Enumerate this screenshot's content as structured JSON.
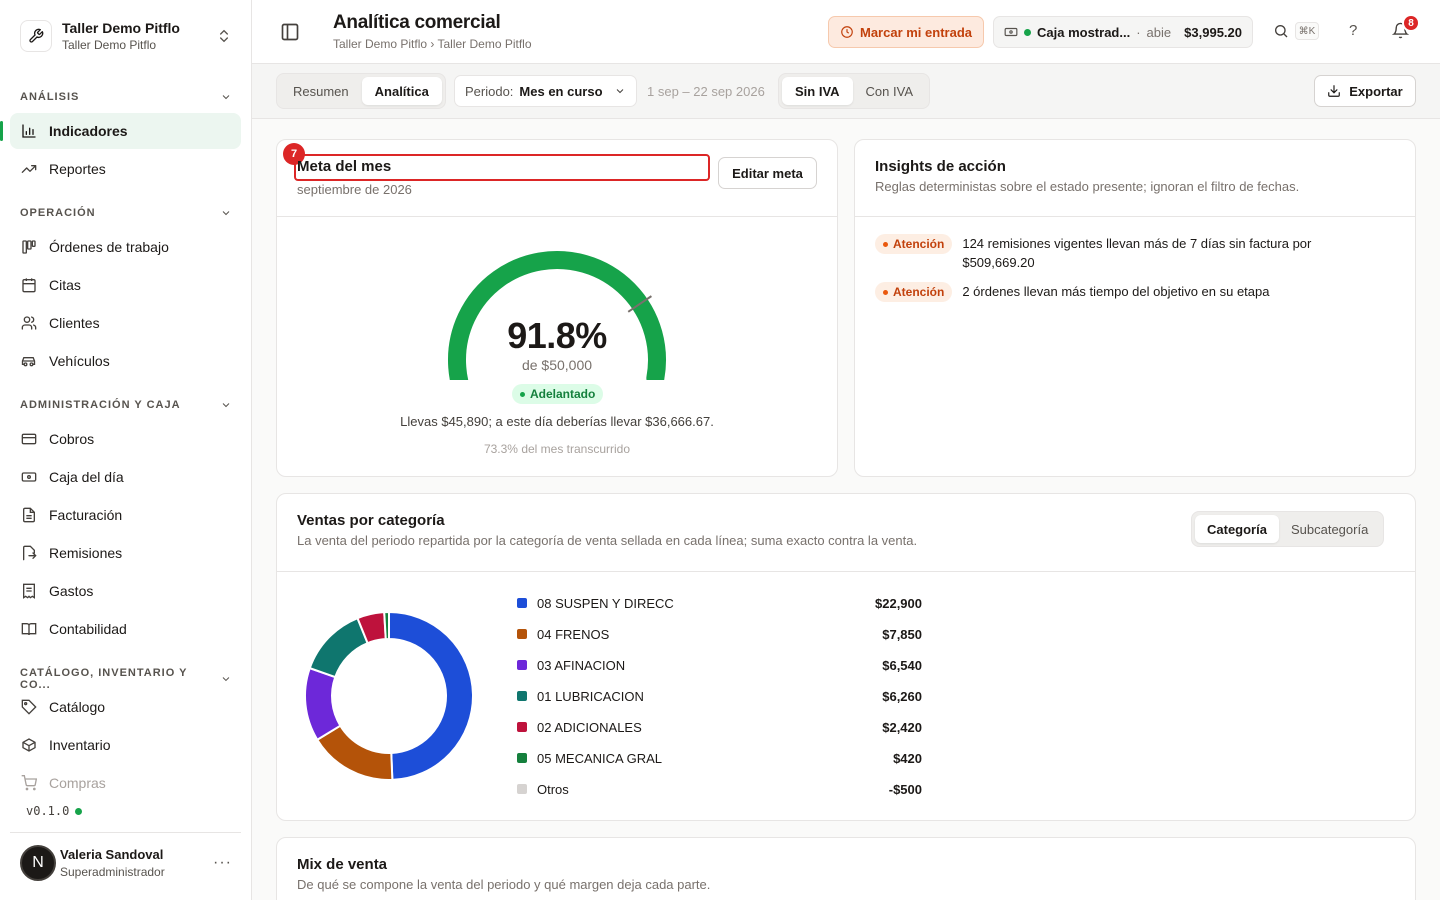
{
  "org": {
    "name": "Taller Demo Pitflo",
    "sub": "Taller Demo Pitflo"
  },
  "sidebar": {
    "sections": [
      {
        "title": "ANÁLISIS"
      },
      {
        "title": "OPERACIÓN"
      },
      {
        "title": "ADMINISTRACIÓN Y CAJA"
      },
      {
        "title": "CATÁLOGO, INVENTARIO Y CO..."
      }
    ],
    "items": [
      {
        "label": "Indicadores",
        "icon": "bar-chart-icon"
      },
      {
        "label": "Reportes",
        "icon": "trending-up-icon"
      },
      {
        "label": "Órdenes de trabajo",
        "icon": "kanban-icon"
      },
      {
        "label": "Citas",
        "icon": "calendar-icon"
      },
      {
        "label": "Clientes",
        "icon": "users-icon"
      },
      {
        "label": "Vehículos",
        "icon": "car-icon"
      },
      {
        "label": "Cobros",
        "icon": "wallet-icon"
      },
      {
        "label": "Caja del día",
        "icon": "banknote-icon"
      },
      {
        "label": "Facturación",
        "icon": "file-text-icon"
      },
      {
        "label": "Remisiones",
        "icon": "file-export-icon"
      },
      {
        "label": "Gastos",
        "icon": "receipt-icon"
      },
      {
        "label": "Contabilidad",
        "icon": "book-icon"
      },
      {
        "label": "Catálogo",
        "icon": "tags-icon"
      },
      {
        "label": "Inventario",
        "icon": "box-icon"
      },
      {
        "label": "Compras",
        "icon": "cart-icon"
      }
    ],
    "version": "v0.1.0"
  },
  "user": {
    "initial": "N",
    "name": "Valeria Sandoval",
    "role": "Superadministrador"
  },
  "header": {
    "title": "Analítica comercial",
    "breadcrumb": "Taller Demo Pitflo › Taller Demo Pitflo",
    "checkin_label": "Marcar mi entrada",
    "cash": {
      "name": "Caja mostrad...",
      "status": "abie",
      "amount": "$3,995.20"
    },
    "shortcut": "⌘K",
    "help": "?",
    "notifications": "8"
  },
  "toolbar": {
    "tabs": [
      "Resumen",
      "Analítica"
    ],
    "period_label": "Periodo:",
    "period_value": "Mes en curso",
    "range": "1 sep – 22 sep 2026",
    "tax_tabs": [
      "Sin IVA",
      "Con IVA"
    ],
    "export_label": "Exportar"
  },
  "goal": {
    "marker": "7",
    "title": "Meta del mes",
    "date": "septiembre de 2026",
    "edit_label": "Editar meta",
    "percent_text": "91.8%",
    "progress": 0.918,
    "expected": 0.733,
    "of_text": "de $50,000",
    "status": "Adelantado",
    "message": "Llevas $45,890; a este día deberías llevar $36,666.67.",
    "elapsed": "73.3% del mes transcurrido",
    "colors": {
      "fill": "#16a34a",
      "track": "#e7e5e4",
      "tick": "#78716c"
    }
  },
  "insights": {
    "title": "Insights de acción",
    "sub": "Reglas deterministas sobre el estado presente; ignoran el filtro de fechas.",
    "items": [
      {
        "tag": "Atención",
        "text": "124 remisiones vigentes llevan más de 7 días sin factura por $509,669.20"
      },
      {
        "tag": "Atención",
        "text": "2 órdenes llevan más tiempo del objetivo en su etapa"
      }
    ]
  },
  "sales": {
    "title": "Ventas por categoría",
    "sub": "La venta del periodo repartida por la categoría de venta sellada en cada línea; suma exacto contra la venta.",
    "tabs": [
      "Categoría",
      "Subcategoría"
    ]
  },
  "chart_data": {
    "type": "pie",
    "categories": [
      "08 SUSPEN Y DIRECC",
      "04 FRENOS",
      "03 AFINACION",
      "01 LUBRICACION",
      "02 ADICIONALES",
      "05 MECANICA GRAL",
      "Otros"
    ],
    "values": [
      22900,
      7850,
      6540,
      6260,
      2420,
      420,
      -500
    ],
    "value_labels": [
      "$22,900",
      "$7,850",
      "$6,540",
      "$6,260",
      "$2,420",
      "$420",
      "-$500"
    ],
    "colors": [
      "#1d4ed8",
      "#b45309",
      "#6d28d9",
      "#0f766e",
      "#be123c",
      "#15803d",
      "#d6d3d1"
    ]
  },
  "mix": {
    "title": "Mix de venta",
    "sub": "De qué se compone la venta del periodo y qué margen deja cada parte."
  }
}
